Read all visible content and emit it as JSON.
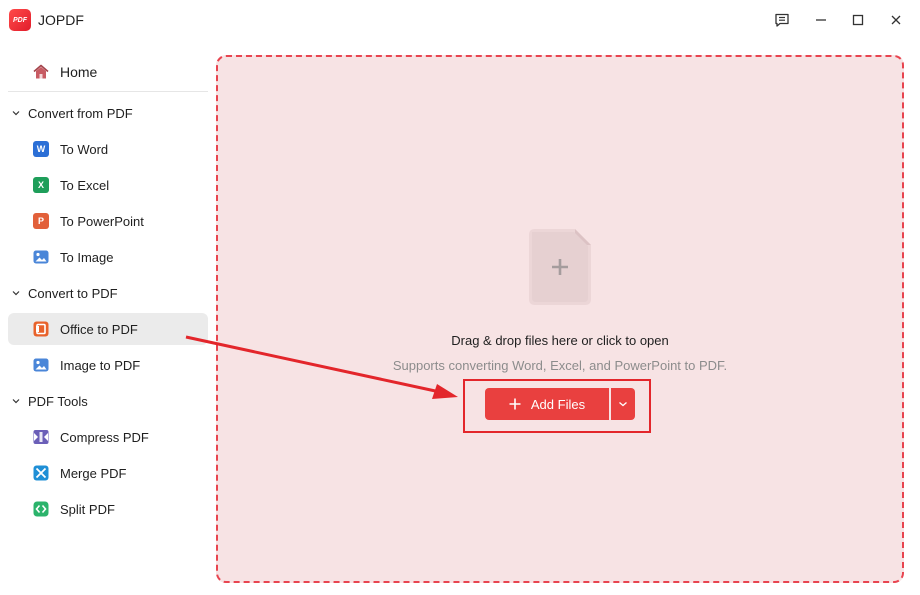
{
  "app": {
    "title": "JOPDF",
    "logo_text": "PDF"
  },
  "sidebar": {
    "home": {
      "label": "Home"
    },
    "groups": [
      {
        "label": "Convert from PDF",
        "items": [
          {
            "label": "To Word",
            "icon": "word-icon",
            "letter": "W",
            "color": "#2b6fd6"
          },
          {
            "label": "To Excel",
            "icon": "excel-icon",
            "letter": "X",
            "color": "#1e9e5a"
          },
          {
            "label": "To PowerPoint",
            "icon": "powerpoint-icon",
            "letter": "P",
            "color": "#e2603a"
          },
          {
            "label": "To Image",
            "icon": "image-icon",
            "color": "#4a86d8"
          }
        ]
      },
      {
        "label": "Convert to PDF",
        "items": [
          {
            "label": "Office to PDF",
            "icon": "office-icon",
            "color": "#e8622b",
            "active": true
          },
          {
            "label": "Image to PDF",
            "icon": "image-icon",
            "color": "#4a86d8"
          }
        ]
      },
      {
        "label": "PDF Tools",
        "items": [
          {
            "label": "Compress PDF",
            "icon": "compress-icon",
            "color": "#6b5fb8"
          },
          {
            "label": "Merge PDF",
            "icon": "merge-icon",
            "color": "#1f8fd6"
          },
          {
            "label": "Split PDF",
            "icon": "split-icon",
            "color": "#2bb36b"
          }
        ]
      }
    ]
  },
  "dropzone": {
    "title": "Drag & drop files here or click to open",
    "subtitle": "Supports converting Word, Excel, and PowerPoint to PDF.",
    "add_button": "Add Files"
  },
  "colors": {
    "accent": "#e9403f",
    "zone_bg": "#f7e3e4",
    "zone_border": "#e8444f"
  }
}
